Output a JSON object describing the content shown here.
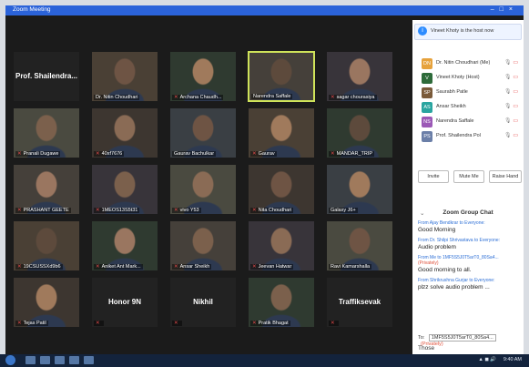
{
  "window": {
    "title": "Zoom Meeting"
  },
  "tiles": [
    {
      "name": "Prof. Shailendra...",
      "video": false,
      "muted": false
    },
    {
      "name": "Dr. Nitin Choudhari",
      "video": true,
      "muted": false
    },
    {
      "name": "Archana Chaudh...",
      "video": true,
      "muted": true
    },
    {
      "name": "Narendra Saffale",
      "video": true,
      "muted": false,
      "active": true
    },
    {
      "name": "sagar chourasiya",
      "video": true,
      "muted": true
    },
    {
      "name": "Pranali Dugawe",
      "video": true,
      "muted": true
    },
    {
      "name": "40xf7676",
      "video": true,
      "muted": true
    },
    {
      "name": "Gaurav Bachulkar",
      "video": true,
      "muted": false
    },
    {
      "name": "Gaurav",
      "video": true,
      "muted": true
    },
    {
      "name": "MANDAR_TRIP",
      "video": true,
      "muted": true
    },
    {
      "name": "PRASHANT GEETE",
      "video": true,
      "muted": true
    },
    {
      "name": "1MEOS13S5t31",
      "video": true,
      "muted": true
    },
    {
      "name": "vivo Y53",
      "video": true,
      "muted": true
    },
    {
      "name": "Nita Choudhari",
      "video": true,
      "muted": true
    },
    {
      "name": "Galaxy J6+",
      "video": true,
      "muted": false
    },
    {
      "name": "19CSUSSXd9b6",
      "video": true,
      "muted": true
    },
    {
      "name": "Aniket Ant Mark...",
      "video": true,
      "muted": true
    },
    {
      "name": "Ansar Sheikh",
      "video": true,
      "muted": true
    },
    {
      "name": "Jeevan Hatwar",
      "video": true,
      "muted": true
    },
    {
      "name": "Ravi Kamarshalla",
      "video": true,
      "muted": false
    },
    {
      "name": "Tejas Patil",
      "video": true,
      "muted": true
    },
    {
      "name": "",
      "label": "Honor 9N",
      "video": false,
      "muted": true
    },
    {
      "name": "",
      "label": "Nikhil",
      "video": false,
      "muted": true
    },
    {
      "name": "Pratik Bhagat",
      "video": true,
      "muted": true
    },
    {
      "name": "",
      "label": "Traffiksevak",
      "video": false,
      "muted": true
    }
  ],
  "notice": "Vineet Khoty is the host now",
  "participants": [
    {
      "initials": "DN",
      "name": "Dr. Nitin Choudhari (Me)",
      "color": "#e6a23c"
    },
    {
      "initials": "V",
      "name": "Vineet Khoty (Host)",
      "color": "#2e6b3a"
    },
    {
      "initials": "SP",
      "name": "Saurabh Patle",
      "color": "#7a5a3a"
    },
    {
      "initials": "AS",
      "name": "Ansar Sheikh",
      "color": "#2aa5a0"
    },
    {
      "initials": "NS",
      "name": "Narendra Saffale",
      "color": "#9b59b6"
    },
    {
      "initials": "PS",
      "name": "Prof. Shailendra Pol",
      "color": "#6b7fa8"
    }
  ],
  "buttons": {
    "invite": "Invite",
    "mute_me": "Mute Me",
    "raise_hand": "Raise Hand"
  },
  "chat": {
    "title": "Zoom Group Chat",
    "messages": [
      {
        "from": "From Ajay Bendkrar to Everyone:",
        "private": "",
        "body": "Good Morning"
      },
      {
        "from": "From Dr. Shilpi Shrivastava to Everyone:",
        "private": "",
        "body": "Audio  problem"
      },
      {
        "from": "From Me to 1MF5S5J0T5arT0_80Sa4...",
        "private": "(Privately)",
        "body": "Good morning to all."
      },
      {
        "from": "From Shrikrushna Gurjar to Everyone:",
        "private": "",
        "body": "plzz solve audio problem ..."
      }
    ],
    "to_label": "To:",
    "to_value": "1MF5S5J0T5arT0_80Sa4...",
    "to_private": "(Privately)",
    "input": "Those"
  },
  "taskbar": {
    "time": "9:40 AM"
  }
}
